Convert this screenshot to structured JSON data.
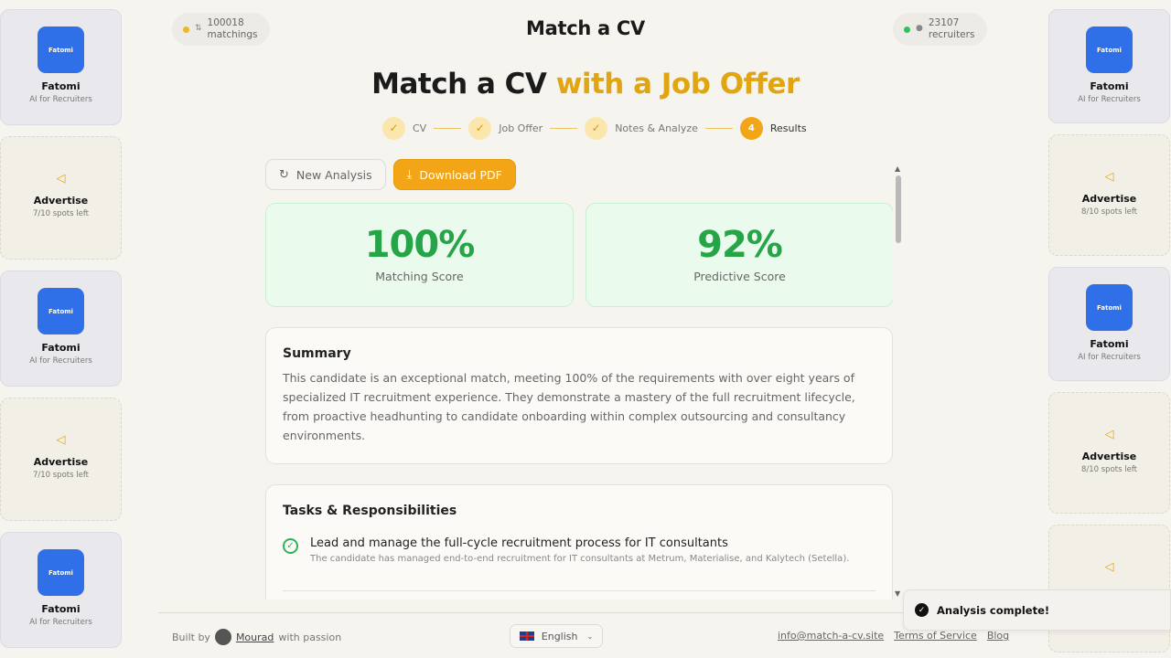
{
  "header": {
    "brand": "Match a CV",
    "left_stat": {
      "value": "100018",
      "label": "matchings"
    },
    "right_stat": {
      "value": "23107",
      "label": "recruiters"
    }
  },
  "hero": {
    "prefix": "Match a CV",
    "accent": "with a Job Offer"
  },
  "stepper": [
    {
      "label": "CV",
      "state": "done"
    },
    {
      "label": "Job Offer",
      "state": "done"
    },
    {
      "label": "Notes & Analyze",
      "state": "done"
    },
    {
      "label": "Results",
      "number": "4",
      "state": "active"
    }
  ],
  "actions": {
    "new_analysis": "New Analysis",
    "download_pdf": "Download PDF"
  },
  "scores": [
    {
      "value": "100%",
      "caption": "Matching Score"
    },
    {
      "value": "92%",
      "caption": "Predictive Score"
    }
  ],
  "summary": {
    "title": "Summary",
    "text": "This candidate is an exceptional match, meeting 100% of the requirements with over eight years of specialized IT recruitment experience. They demonstrate a mastery of the full recruitment lifecycle, from proactive headhunting to candidate onboarding within complex outsourcing and consultancy environments."
  },
  "tasks": {
    "title": "Tasks & Responsibilities",
    "items": [
      {
        "title": "Lead and manage the full-cycle recruitment process for IT consultants",
        "detail": "The candidate has managed end-to-end recruitment for IT consultants at Metrum, Materialise, and Kalytech (Setella)."
      }
    ]
  },
  "sponsor": {
    "logo_text": "Fatomi",
    "name": "Fatomi",
    "tagline": "AI for Recruiters"
  },
  "left_rail": [
    {
      "type": "sponsor"
    },
    {
      "type": "advert",
      "title": "Advertise",
      "spots": "7/10 spots left"
    },
    {
      "type": "sponsor"
    },
    {
      "type": "advert",
      "title": "Advertise",
      "spots": "7/10 spots left"
    },
    {
      "type": "sponsor"
    }
  ],
  "right_rail": [
    {
      "type": "sponsor"
    },
    {
      "type": "advert",
      "title": "Advertise",
      "spots": "8/10 spots left"
    },
    {
      "type": "sponsor"
    },
    {
      "type": "advert",
      "title": "Advertise",
      "spots": "8/10 spots left"
    },
    {
      "type": "advert",
      "title": "",
      "spots": ""
    }
  ],
  "footer": {
    "built_by": "Built by",
    "author": "Mourad",
    "with_passion": "with passion",
    "language": "English",
    "email": "info@match-a-cv.site",
    "terms": "Terms of Service",
    "blog": "Blog"
  },
  "toast": {
    "message": "Analysis complete!"
  },
  "colors": {
    "accent": "#e2a512",
    "score_green": "#26a548",
    "sponsor_blue": "#2f6fe8"
  },
  "icons": {
    "advert": "megaphone-icon",
    "toast": "check-circle-icon"
  }
}
